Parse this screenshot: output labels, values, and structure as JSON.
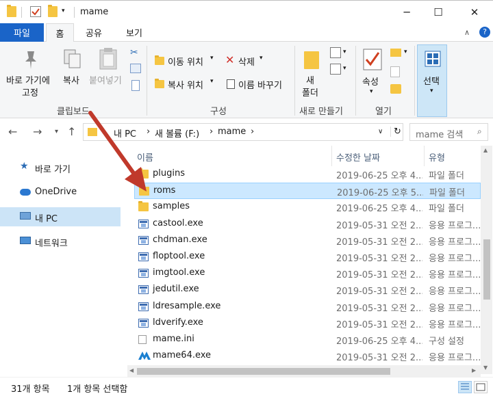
{
  "window": {
    "title": "mame",
    "minimize": "─",
    "maximize": "☐",
    "close": "✕"
  },
  "tabs": [
    {
      "label": "파일"
    },
    {
      "label": "홈"
    },
    {
      "label": "공유"
    },
    {
      "label": "보기"
    }
  ],
  "ribbon": {
    "pin_label_1": "바로 가기에",
    "pin_label_2": "고정",
    "copy_label": "복사",
    "paste_label": "붙여넣기",
    "clipboard_group": "클립보드",
    "move_to": "이동 위치",
    "copy_to": "복사 위치",
    "delete": "삭제",
    "rename": "이름 바꾸기",
    "organize_group": "구성",
    "new_folder_1": "새",
    "new_folder_2": "폴더",
    "new_group": "새로 만들기",
    "properties": "속성",
    "open_group": "열기",
    "select": "선택"
  },
  "address": {
    "crumbs": [
      "내 PC",
      "새 볼륨 (F:)",
      "mame"
    ],
    "search_placeholder": "mame 검색"
  },
  "nav": [
    {
      "label": "바로 가기"
    },
    {
      "label": "OneDrive"
    },
    {
      "label": "내 PC"
    },
    {
      "label": "네트워크"
    }
  ],
  "columns": {
    "name": "이름",
    "date": "수정한 날짜",
    "type": "유형"
  },
  "files": [
    {
      "name": "plugins",
      "date": "2019-06-25 오후 4...",
      "type": "파일 폴더",
      "icon": "folder-icon"
    },
    {
      "name": "roms",
      "date": "2019-06-25 오후 5...",
      "type": "파일 폴더",
      "icon": "folder-icon"
    },
    {
      "name": "samples",
      "date": "2019-06-25 오후 4...",
      "type": "파일 폴더",
      "icon": "folder-icon"
    },
    {
      "name": "castool.exe",
      "date": "2019-05-31 오전 2...",
      "type": "응용 프로그...",
      "icon": "exe-icon"
    },
    {
      "name": "chdman.exe",
      "date": "2019-05-31 오전 2...",
      "type": "응용 프로그...",
      "icon": "exe-icon"
    },
    {
      "name": "floptool.exe",
      "date": "2019-05-31 오전 2...",
      "type": "응용 프로그...",
      "icon": "exe-icon"
    },
    {
      "name": "imgtool.exe",
      "date": "2019-05-31 오전 2...",
      "type": "응용 프로그...",
      "icon": "exe-icon"
    },
    {
      "name": "jedutil.exe",
      "date": "2019-05-31 오전 2...",
      "type": "응용 프로그...",
      "icon": "exe-icon"
    },
    {
      "name": "ldresample.exe",
      "date": "2019-05-31 오전 2...",
      "type": "응용 프로그...",
      "icon": "exe-icon"
    },
    {
      "name": "ldverify.exe",
      "date": "2019-05-31 오전 2...",
      "type": "응용 프로그...",
      "icon": "exe-icon"
    },
    {
      "name": "mame.ini",
      "date": "2019-06-25 오후 4...",
      "type": "구성 설정",
      "icon": "ini-icon"
    },
    {
      "name": "mame64.exe",
      "date": "2019-05-31 오전 2...",
      "type": "응용 프로그...",
      "icon": "mame-icon"
    }
  ],
  "status": {
    "item_count": "31개 항목",
    "selected": "1개 항목 선택함"
  },
  "colors": {
    "accent": "#1a64c8",
    "selection": "#cce8ff",
    "arrow": "#c0392b"
  }
}
